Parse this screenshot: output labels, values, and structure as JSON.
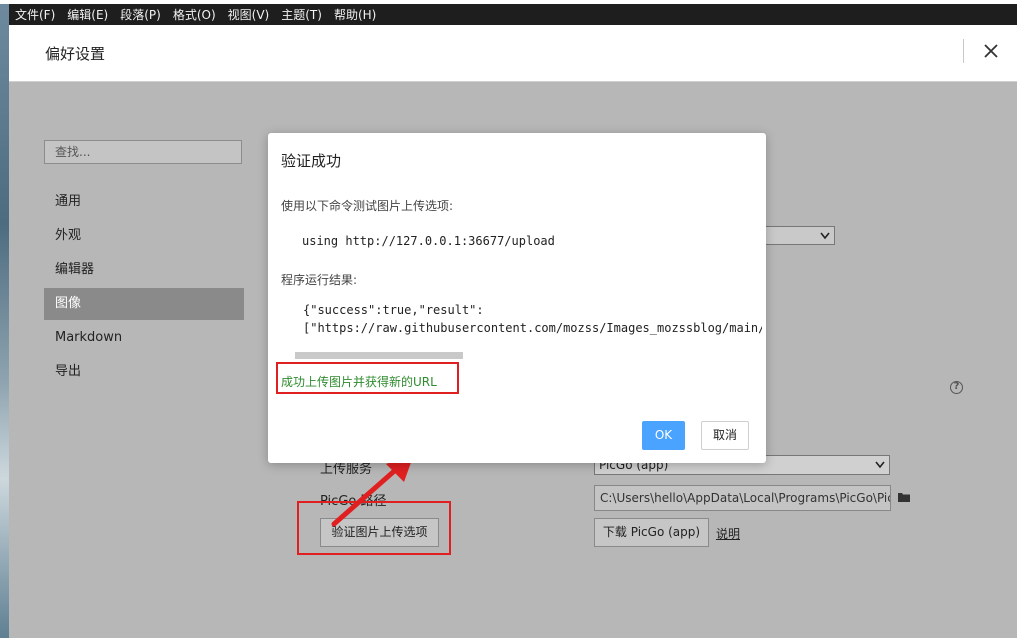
{
  "menubar": {
    "items": [
      "文件(F)",
      "编辑(E)",
      "段落(P)",
      "格式(O)",
      "视图(V)",
      "主题(T)",
      "帮助(H)"
    ]
  },
  "prefs": {
    "title": "偏好设置",
    "search_placeholder": "查找...",
    "nav": [
      "通用",
      "外观",
      "编辑器",
      "图像",
      "Markdown",
      "导出"
    ],
    "active_nav": "图像"
  },
  "image_settings": {
    "upload_service_label": "上传服务",
    "upload_service_value": "PicGo (app)",
    "picgo_path_label": "PicGo 路径",
    "picgo_path_value": "C:\\Users\\hello\\AppData\\Local\\Programs\\PicGo\\PicGo.",
    "verify_button": "验证图片上传选项",
    "download_button": "下载 PicGo (app)",
    "explain_link": "说明",
    "help_icon": "?"
  },
  "dialog": {
    "title": "验证成功",
    "description": "使用以下命令测试图片上传选项:",
    "command": "using http://127.0.0.1:36677/upload",
    "result_label": "程序运行结果:",
    "result_lines": [
      "{\"success\":true,\"result\":",
      "[\"https://raw.githubusercontent.com/mozss/Images_mozssblog/main/"
    ],
    "success_message": "成功上传图片并获得新的URL",
    "ok_button": "OK",
    "cancel_button": "取消"
  },
  "colors": {
    "primary_button": "#4aa3ff",
    "success_text": "#2e8b2e",
    "annotation_red": "#e02020"
  }
}
